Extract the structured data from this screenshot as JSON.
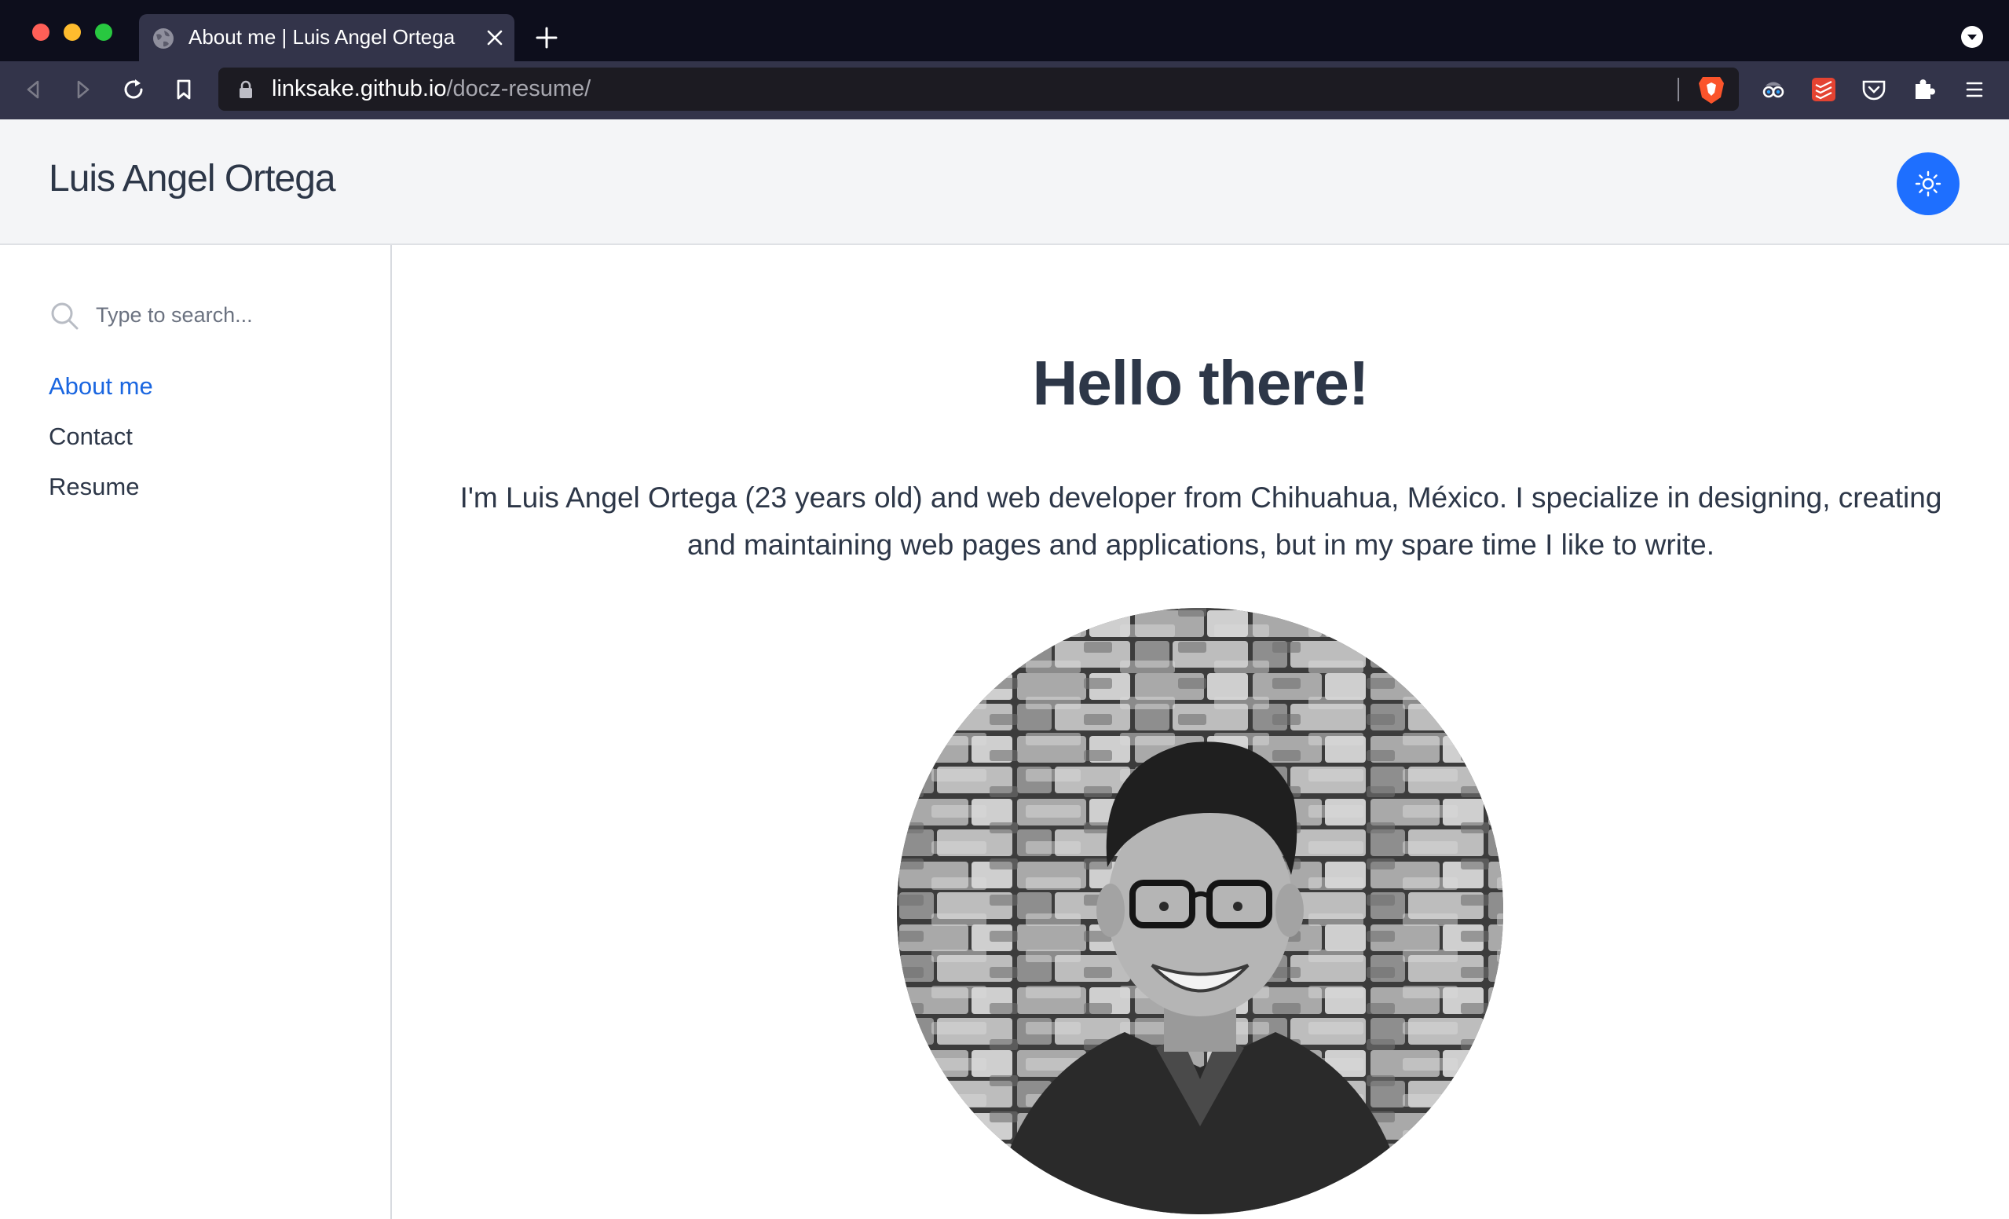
{
  "browser": {
    "tab_title": "About me | Luis Angel Ortega",
    "url_host": "linksake.github.io",
    "url_path": "/docz-resume/"
  },
  "header": {
    "site_title": "Luis Angel Ortega",
    "theme_toggle_icon": "sun-icon",
    "accent_color": "#1e6fff"
  },
  "sidebar": {
    "search_placeholder": "Type to search...",
    "items": [
      {
        "label": "About me",
        "active": true
      },
      {
        "label": "Contact",
        "active": false
      },
      {
        "label": "Resume",
        "active": false
      }
    ]
  },
  "main": {
    "heading": "Hello there!",
    "intro_line_1": "I'm Luis Angel Ortega (23 years old) and web developer from Chihuahua, México. I specialize in designing, creating",
    "intro_line_2": "and maintaining web pages and applications, but in my spare time I like to write."
  }
}
